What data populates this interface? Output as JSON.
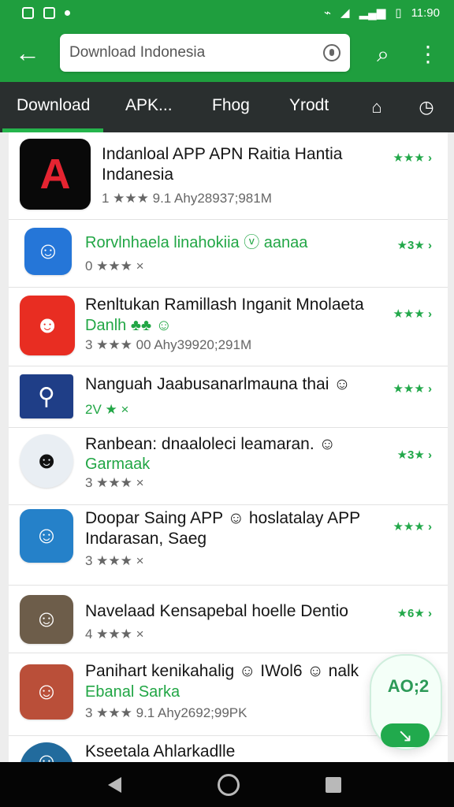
{
  "status": {
    "time": "11:90"
  },
  "search": {
    "value": "Download Indonesia"
  },
  "tabs": [
    {
      "label": "Download"
    },
    {
      "label": "APK..."
    },
    {
      "label": "Fhog"
    },
    {
      "label": "Yrodt"
    }
  ],
  "rows": [
    {
      "title": "Indanloal APP APN Raitia Hantia",
      "subtitle": "Indanesia",
      "meta": "1 ★★★ 9.1 Ahy28937;981M",
      "rating": "★★★ ›",
      "icon": "A"
    },
    {
      "title": "Rorvlnhaela linahokiia ⓥ aanaa",
      "subtitle": "",
      "meta": "0 ★★★ ×",
      "rating": "★3★ ›",
      "icon": "☺"
    },
    {
      "title": "Renltukan Ramillash Inganit Mnolaeta",
      "subtitle": "Danlh ♣♣ ☺",
      "meta": "3 ★★★ 00 Ahy39920;291M",
      "rating": "★★★ ›",
      "icon": "☻"
    },
    {
      "title": "Nanguah Jaabusanarlmauna thai ☺",
      "subtitle": "",
      "meta": "2V ★ ×",
      "rating": "★★★ ›",
      "icon": "⚲"
    },
    {
      "title": "Ranbean: dnaaloleci leamaran. ☺",
      "subtitle": "Garmaak",
      "meta": "3 ★★★ ×",
      "rating": "★3★ ›",
      "icon": "☻"
    },
    {
      "title": "Doopar Saing APP ☺ hoslatalay APP",
      "subtitle": "Indarasan, Saeg",
      "meta": "3 ★★★ ×",
      "rating": "★★★ ›",
      "icon": "☺"
    },
    {
      "title": "Navelaad Kensapebal hoelle Dentio",
      "subtitle": "",
      "meta": "4 ★★★ ×",
      "rating": "★6★ ›",
      "icon": "☺"
    },
    {
      "title": "Panihart kenikahalig ☺ IWol6 ☺ nalk",
      "subtitle": "Ebanal Sarka",
      "meta": "3 ★★★ 9.1 Ahy2692;99PK",
      "rating": "★★★ ›",
      "icon": "☺"
    },
    {
      "title": "Kseetala Ahlarkadlle",
      "subtitle": "",
      "meta": "",
      "rating": "",
      "icon": "☺"
    }
  ],
  "fab": {
    "value": "AO;2"
  }
}
